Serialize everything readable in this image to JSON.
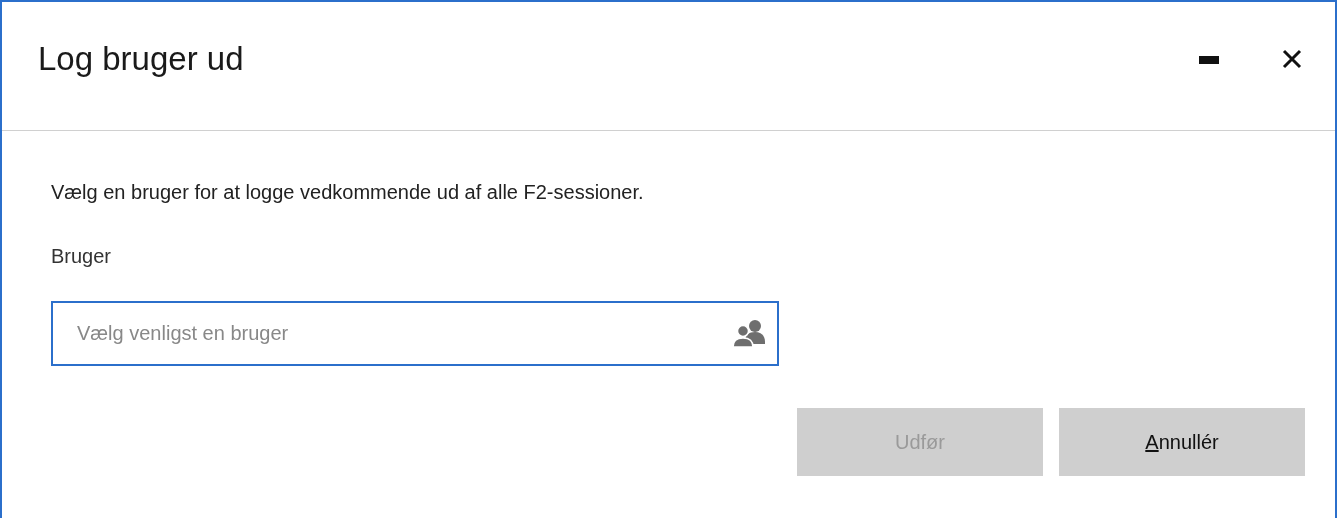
{
  "window": {
    "title": "Log bruger ud"
  },
  "message": "Vælg en bruger for at logge vedkommende ud af alle F2-sessioner.",
  "user_field": {
    "label": "Bruger",
    "placeholder": "Vælg venligst en bruger",
    "focused": true
  },
  "buttons": [
    {
      "label": "Udfør",
      "first_letter_underlined": false,
      "disabled": true
    },
    {
      "label": "Annullér",
      "first_letter_underlined": true,
      "disabled": false
    }
  ]
}
